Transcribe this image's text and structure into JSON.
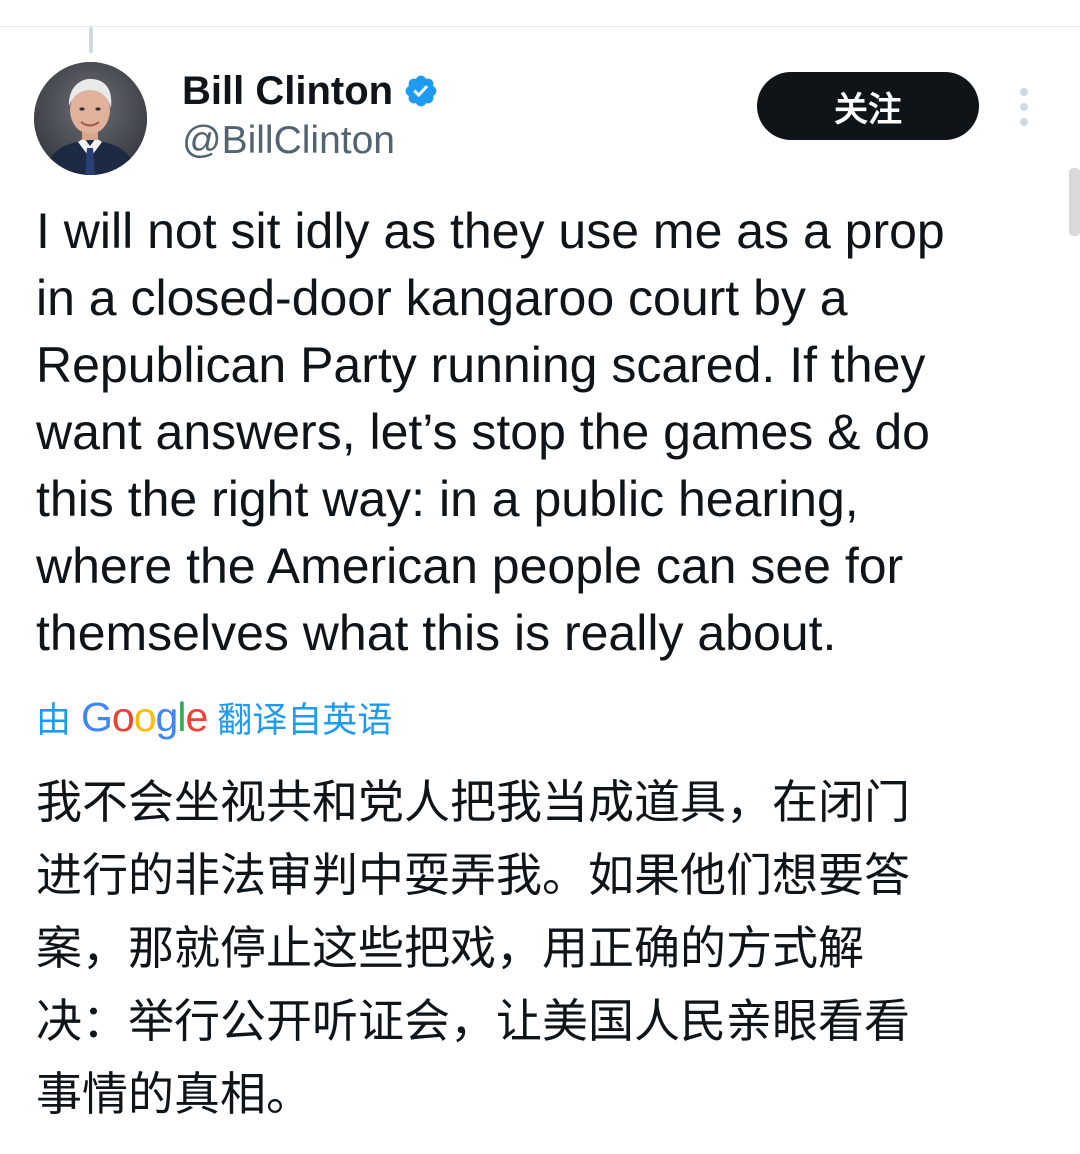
{
  "author": {
    "display_name": "Bill Clinton",
    "handle": "@BillClinton",
    "verified": true
  },
  "follow_button": {
    "label": "关注"
  },
  "tweet": {
    "lines": [
      "I will not sit idly as they use me as a prop",
      "in a closed-door kangaroo court by a",
      "Republican Party running scared. If they",
      "want answers, let’s stop the games & do",
      "this the right way: in a public hearing,",
      "where the American people can see for",
      "themselves what this is really about."
    ]
  },
  "translation": {
    "prefix": "由",
    "provider": "Google",
    "suffix": "翻译自英语",
    "lines": [
      "我不会坐视共和党人把我当成道具，在闭门",
      "进行的非法审判中耍弄我。如果他们想要答",
      "案，那就停止这些把戏，用正确的方式解",
      "决：举行公开听证会，让美国人民亲眼看看",
      "事情的真相。"
    ]
  },
  "icons": {
    "avatar": "profile-photo",
    "verified": "verified-badge-icon",
    "more": "more-vertical-icon"
  },
  "colors": {
    "accent": "#1d9bf0",
    "follow_bg": "#0f1419",
    "secondary_text": "#536471"
  }
}
